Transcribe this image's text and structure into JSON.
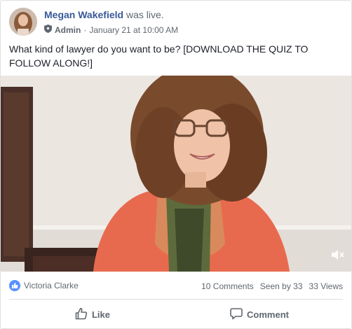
{
  "post": {
    "author": "Megan Wakefield",
    "status_text": "was live.",
    "role": "Admin",
    "separator": "·",
    "timestamp": "January 21 at 10:00 AM",
    "text": "What kind of lawyer do you want to be? [DOWNLOAD THE QUIZ TO FOLLOW ALONG!]"
  },
  "video": {
    "muted": true
  },
  "stats": {
    "reactor": "Victoria Clarke",
    "comments": "10 Comments",
    "seen_by": "Seen by 33",
    "views": "33 Views"
  },
  "actions": {
    "like_label": "Like",
    "comment_label": "Comment"
  },
  "colors": {
    "author_link": "#385898",
    "like_badge": "#5890ff",
    "secondary_text": "#606770"
  }
}
